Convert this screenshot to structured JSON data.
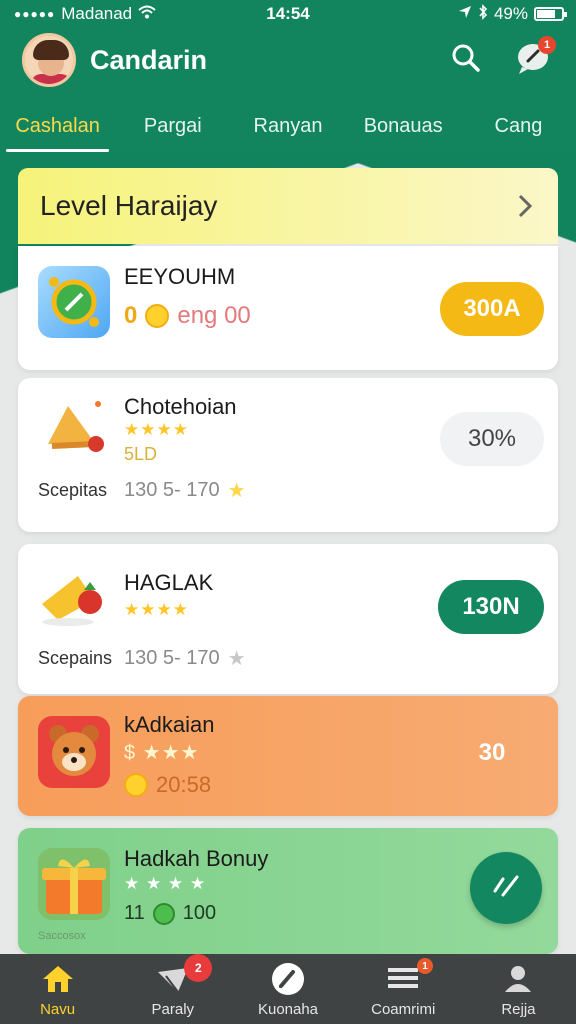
{
  "status": {
    "carrier": "Madanad",
    "time": "14:54",
    "battery": "49%"
  },
  "app": {
    "title": "Candarin"
  },
  "notifications": {
    "badge": "1"
  },
  "tabs": [
    {
      "label": "Cashalan",
      "active": true
    },
    {
      "label": "Pargai",
      "active": false
    },
    {
      "label": "Ranyan",
      "active": false
    },
    {
      "label": "Bonauas",
      "active": false
    },
    {
      "label": "Cang",
      "active": false
    }
  ],
  "level_banner": {
    "title": "Level Haraijay"
  },
  "cards": [
    {
      "title": "EEYOUHM",
      "stats": "0",
      "stats2": "eng 00",
      "pill": "300A",
      "pill_color": "#f5b915"
    },
    {
      "title": "Chotehoian",
      "stars": "★★★★",
      "sub": "5LD",
      "footer": "Scepitas",
      "range": "130 5- 170",
      "pill": "30%",
      "pill_color": "#f1f2f3"
    },
    {
      "title": "HAGLAK",
      "stars": "★★★★",
      "footer": "Scepains",
      "range": "130 5- 170",
      "pill": "130N",
      "pill_color": "#13875f"
    },
    {
      "title": "kAdkaian",
      "stars": "$ ★★★",
      "stats": "20:58",
      "pill": "30"
    },
    {
      "title": "Hadkah Bonuy",
      "stars": "★ ★ ★ ★",
      "stats": "11",
      "stats2": "100",
      "footer": "Saccosox"
    }
  ],
  "bottom_nav": [
    {
      "label": "Navu",
      "active": true
    },
    {
      "label": "Paraly",
      "active": false,
      "badge": "2"
    },
    {
      "label": "Kuonaha",
      "active": false
    },
    {
      "label": "Coamrimi",
      "active": false,
      "badge": "1"
    },
    {
      "label": "Rejja",
      "active": false
    }
  ]
}
